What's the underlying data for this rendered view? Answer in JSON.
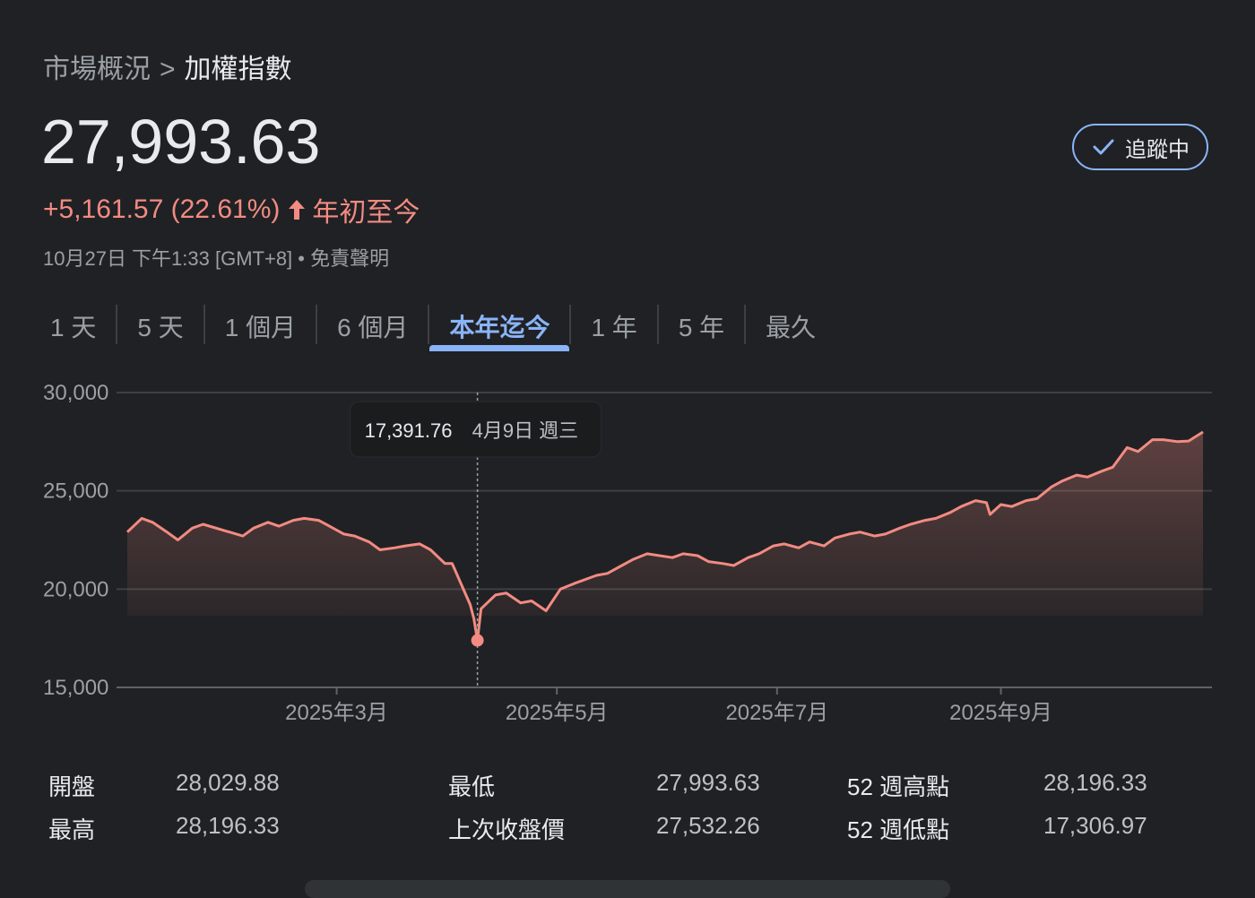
{
  "breadcrumb": {
    "parent": "市場概況",
    "separator": ">",
    "current": "加權指數"
  },
  "quote": {
    "price": "27,993.63",
    "change": "+5,161.57 (22.61%)",
    "period": "年初至今",
    "meta": "10月27日 下午1:33 [GMT+8] • 免責聲明"
  },
  "follow_button": {
    "label": "追蹤中"
  },
  "tabs": [
    {
      "label": "1 天"
    },
    {
      "label": "5 天"
    },
    {
      "label": "1 個月"
    },
    {
      "label": "6 個月"
    },
    {
      "label": "本年迄今",
      "active": true
    },
    {
      "label": "1 年"
    },
    {
      "label": "5 年"
    },
    {
      "label": "最久"
    }
  ],
  "tooltip": {
    "value": "17,391.76",
    "date": "4月9日 週三"
  },
  "colors": {
    "line": "#f28b82",
    "accent": "#8ab4f8",
    "background": "#202124"
  },
  "chart_data": {
    "type": "area",
    "ylim": [
      15000,
      30000
    ],
    "y_ticks": [
      "30,000",
      "25,000",
      "20,000",
      "15,000"
    ],
    "x_ticks": [
      "2025年3月",
      "2025年5月",
      "2025年7月",
      "2025年9月"
    ],
    "xlim": [
      "2025-01-02",
      "2025-10-27"
    ],
    "grid": true,
    "highlight": {
      "x": "2025-04-09",
      "y": 17391.76
    },
    "series": [
      {
        "values": [
          [
            "2025-01-02",
            22900
          ],
          [
            "2025-01-06",
            23600
          ],
          [
            "2025-01-09",
            23400
          ],
          [
            "2025-01-13",
            22900
          ],
          [
            "2025-01-16",
            22500
          ],
          [
            "2025-01-20",
            23100
          ],
          [
            "2025-01-23",
            23300
          ],
          [
            "2025-02-03",
            22700
          ],
          [
            "2025-02-06",
            23100
          ],
          [
            "2025-02-10",
            23400
          ],
          [
            "2025-02-13",
            23200
          ],
          [
            "2025-02-17",
            23500
          ],
          [
            "2025-02-20",
            23600
          ],
          [
            "2025-02-24",
            23500
          ],
          [
            "2025-02-27",
            23200
          ],
          [
            "2025-03-03",
            22800
          ],
          [
            "2025-03-06",
            22700
          ],
          [
            "2025-03-10",
            22400
          ],
          [
            "2025-03-13",
            22000
          ],
          [
            "2025-03-17",
            22100
          ],
          [
            "2025-03-20",
            22200
          ],
          [
            "2025-03-24",
            22300
          ],
          [
            "2025-03-27",
            22000
          ],
          [
            "2025-03-31",
            21300
          ],
          [
            "2025-04-01",
            21300
          ],
          [
            "2025-04-02",
            21300
          ],
          [
            "2025-04-07",
            19200
          ],
          [
            "2025-04-08",
            18500
          ],
          [
            "2025-04-09",
            17391.76
          ],
          [
            "2025-04-10",
            19000
          ],
          [
            "2025-04-14",
            19700
          ],
          [
            "2025-04-17",
            19800
          ],
          [
            "2025-04-21",
            19300
          ],
          [
            "2025-04-24",
            19400
          ],
          [
            "2025-04-28",
            18900
          ],
          [
            "2025-05-02",
            20000
          ],
          [
            "2025-05-06",
            20300
          ],
          [
            "2025-05-12",
            20700
          ],
          [
            "2025-05-15",
            20800
          ],
          [
            "2025-05-19",
            21200
          ],
          [
            "2025-05-22",
            21500
          ],
          [
            "2025-05-26",
            21800
          ],
          [
            "2025-06-02",
            21600
          ],
          [
            "2025-06-05",
            21800
          ],
          [
            "2025-06-09",
            21700
          ],
          [
            "2025-06-12",
            21400
          ],
          [
            "2025-06-16",
            21300
          ],
          [
            "2025-06-19",
            21200
          ],
          [
            "2025-06-23",
            21600
          ],
          [
            "2025-06-26",
            21800
          ],
          [
            "2025-06-30",
            22200
          ],
          [
            "2025-07-03",
            22300
          ],
          [
            "2025-07-07",
            22100
          ],
          [
            "2025-07-10",
            22400
          ],
          [
            "2025-07-14",
            22200
          ],
          [
            "2025-07-17",
            22600
          ],
          [
            "2025-07-21",
            22800
          ],
          [
            "2025-07-24",
            22900
          ],
          [
            "2025-07-28",
            22700
          ],
          [
            "2025-07-31",
            22800
          ],
          [
            "2025-08-04",
            23100
          ],
          [
            "2025-08-07",
            23300
          ],
          [
            "2025-08-11",
            23500
          ],
          [
            "2025-08-14",
            23600
          ],
          [
            "2025-08-18",
            23900
          ],
          [
            "2025-08-21",
            24200
          ],
          [
            "2025-08-25",
            24500
          ],
          [
            "2025-08-28",
            24400
          ],
          [
            "2025-08-29",
            23800
          ],
          [
            "2025-09-01",
            24300
          ],
          [
            "2025-09-04",
            24200
          ],
          [
            "2025-09-08",
            24500
          ],
          [
            "2025-09-11",
            24600
          ],
          [
            "2025-09-15",
            25200
          ],
          [
            "2025-09-18",
            25500
          ],
          [
            "2025-09-22",
            25800
          ],
          [
            "2025-09-25",
            25700
          ],
          [
            "2025-09-29",
            26000
          ],
          [
            "2025-10-02",
            26200
          ],
          [
            "2025-10-06",
            27200
          ],
          [
            "2025-10-09",
            27000
          ],
          [
            "2025-10-13",
            27600
          ],
          [
            "2025-10-16",
            27600
          ],
          [
            "2025-10-20",
            27500
          ],
          [
            "2025-10-23",
            27532.26
          ],
          [
            "2025-10-27",
            27993.63
          ]
        ]
      }
    ]
  },
  "stats": {
    "open": {
      "label": "開盤",
      "value": "28,029.88"
    },
    "high": {
      "label": "最高",
      "value": "28,196.33"
    },
    "low": {
      "label": "最低",
      "value": "27,993.63"
    },
    "prev_close": {
      "label": "上次收盤價",
      "value": "27,532.26"
    },
    "wk52_high": {
      "label": "52 週高點",
      "value": "28,196.33"
    },
    "wk52_low": {
      "label": "52 週低點",
      "value": "17,306.97"
    }
  }
}
